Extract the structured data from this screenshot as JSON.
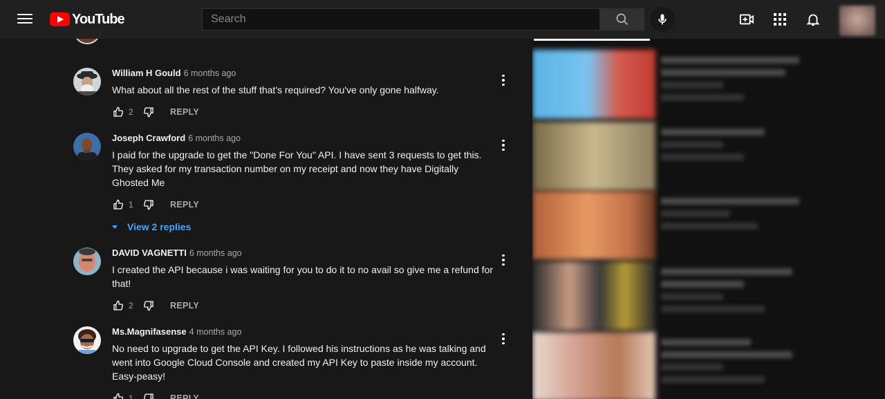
{
  "header": {
    "logo_text": "YouTube",
    "search_placeholder": "Search",
    "icons": [
      "menu-icon",
      "search-icon",
      "mic-icon",
      "create-video-icon",
      "apps-icon",
      "notifications-icon"
    ]
  },
  "comments": [
    {
      "author": "William H Gould",
      "time": "6 months ago",
      "text": "What about all the rest of the stuff that's required? You've only gone halfway.",
      "likes": "2",
      "reply_label": "REPLY"
    },
    {
      "author": "Joseph Crawford",
      "time": "6 months ago",
      "text": "I paid for the upgrade to get the \"Done For You\" API. I have sent 3 requests to get this. They asked for my transaction number on my receipt and now they have Digitally Ghosted Me",
      "likes": "1",
      "reply_label": "REPLY",
      "view_replies": "View 2 replies"
    },
    {
      "author": "DAVID VAGNETTI",
      "time": "6 months ago",
      "text": "I created the API because i was waiting for you to do it to no avail so give me a refund for that!",
      "likes": "2",
      "reply_label": "REPLY"
    },
    {
      "author": "Ms.Magnifasense",
      "time": "4 months ago",
      "text": "No need to upgrade to get the API Key. I followed his instructions as he was talking and went into Google Cloud Console and created my API Key to paste inside my account. Easy-peasy!",
      "likes": "1",
      "reply_label": "REPLY"
    }
  ],
  "colors": {
    "background": "#181818",
    "link_blue": "#3ea6ff",
    "brand_red": "#ff0000"
  }
}
